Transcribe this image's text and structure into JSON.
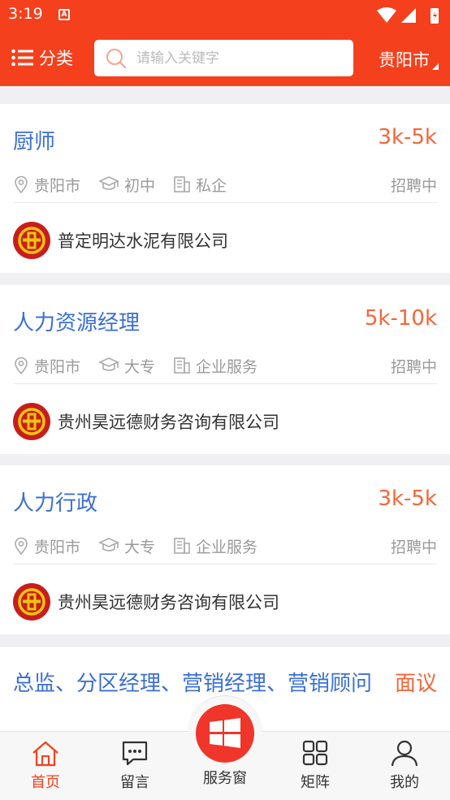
{
  "status": {
    "time": "3:19",
    "a_label": "A"
  },
  "header": {
    "category_label": "分类",
    "search_placeholder": "请输入关键字",
    "city": "贵阳市"
  },
  "jobs": [
    {
      "title": "厨师",
      "salary": "3k-5k",
      "location": "贵阳市",
      "education": "初中",
      "company_type": "私企",
      "status": "招聘中",
      "company": "普定明达水泥有限公司"
    },
    {
      "title": "人力资源经理",
      "salary": "5k-10k",
      "location": "贵阳市",
      "education": "大专",
      "company_type": "企业服务",
      "status": "招聘中",
      "company": "贵州昊远德财务咨询有限公司"
    },
    {
      "title": "人力行政",
      "salary": "3k-5k",
      "location": "贵阳市",
      "education": "大专",
      "company_type": "企业服务",
      "status": "招聘中",
      "company": "贵州昊远德财务咨询有限公司"
    },
    {
      "title": "总监、分区经理、营销经理、营销顾问",
      "salary": "面议"
    }
  ],
  "nav": {
    "home": "首页",
    "message": "留言",
    "service": "服务窗",
    "matrix": "矩阵",
    "mine": "我的"
  },
  "colors": {
    "brand": "#f5401d",
    "title_blue": "#3b6fd4",
    "salary_orange": "#f3673a"
  }
}
